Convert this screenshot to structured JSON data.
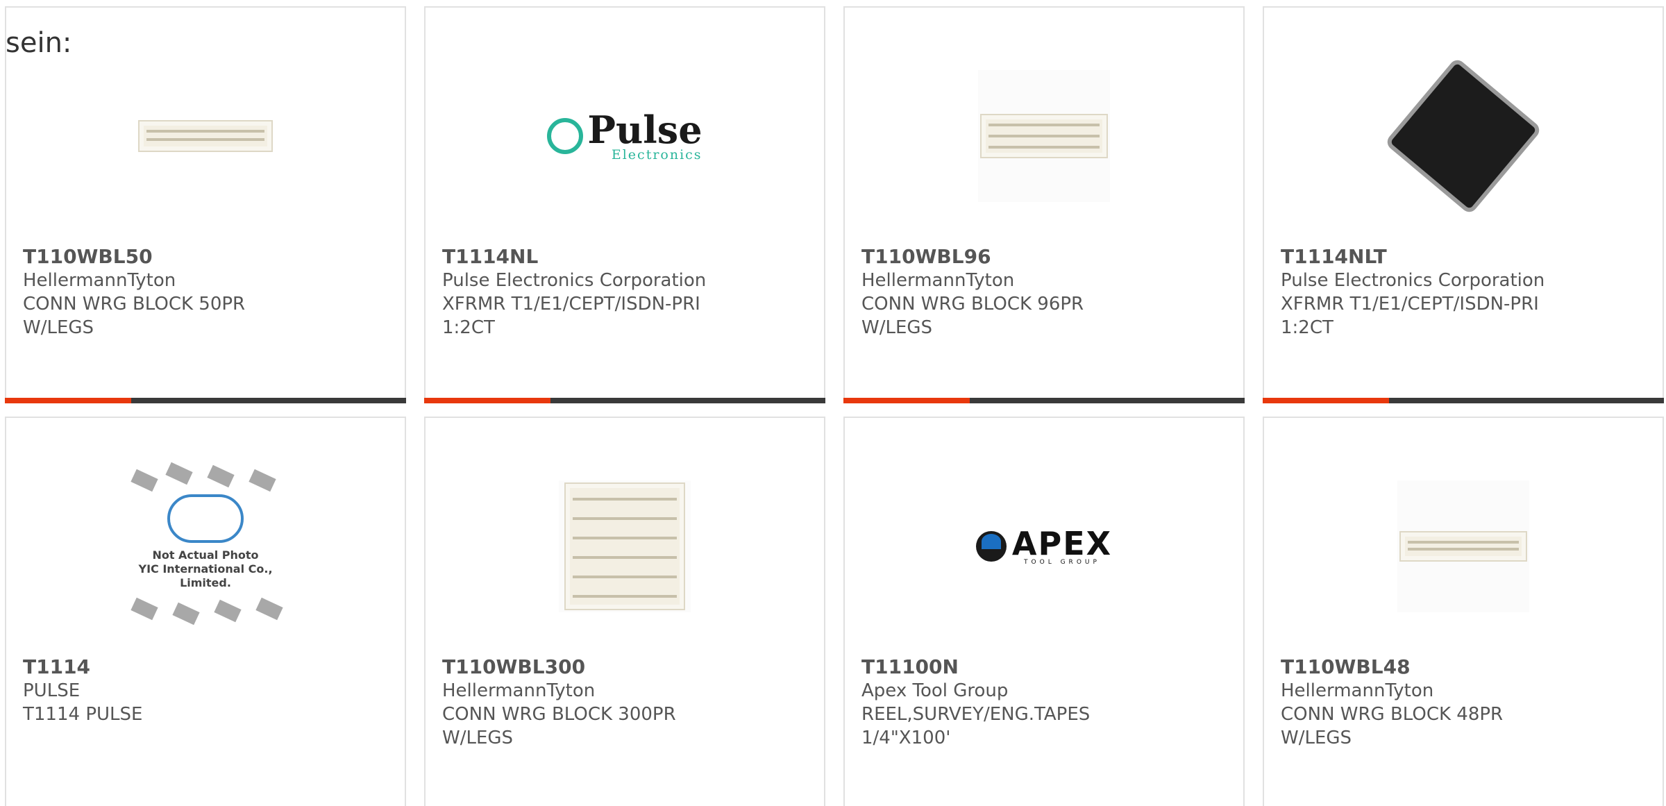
{
  "lead_text": "sein:",
  "products": [
    {
      "pn": "T110WBL50",
      "mfr": "HellermannTyton",
      "desc": "CONN WRG BLOCK 50PR W/LEGS",
      "image": "wiring-block-50pr"
    },
    {
      "pn": "T1114NL",
      "mfr": "Pulse Electronics Corporation",
      "desc": "XFRMR T1/E1/CEPT/ISDN-PRI 1:2CT",
      "image": "pulse-logo"
    },
    {
      "pn": "T110WBL96",
      "mfr": "HellermannTyton",
      "desc": "CONN WRG BLOCK 96PR W/LEGS",
      "image": "wiring-block-96pr"
    },
    {
      "pn": "T1114NLT",
      "mfr": "Pulse Electronics Corporation",
      "desc": "XFRMR T1/E1/CEPT/ISDN-PRI 1:2CT",
      "image": "smd-transformer"
    },
    {
      "pn": "T1114",
      "mfr": "PULSE",
      "desc": "T1114 PULSE",
      "image": "yic-not-actual-photo"
    },
    {
      "pn": "T110WBL300",
      "mfr": "HellermannTyton",
      "desc": "CONN WRG BLOCK 300PR W/LEGS",
      "image": "wiring-block-300pr"
    },
    {
      "pn": "T11100N",
      "mfr": "Apex Tool Group",
      "desc": "REEL,SURVEY/ENG.TAPES 1/4\"X100'",
      "image": "apex-logo"
    },
    {
      "pn": "T110WBL48",
      "mfr": "HellermannTyton",
      "desc": "CONN WRG BLOCK 48PR W/LEGS",
      "image": "wiring-block-48pr"
    }
  ],
  "logos": {
    "pulse_main": "Pulse",
    "pulse_sub": "Electronics",
    "apex_main": "APEX",
    "apex_sub": "TOOL GROUP"
  },
  "yic_caption": {
    "line1": "Not Actual Photo",
    "line2": "YIC International Co., Limited."
  },
  "colors": {
    "accent": "#e8380d",
    "bar": "#3a3a3a",
    "border": "#e1e1e1",
    "text": "#555555"
  }
}
